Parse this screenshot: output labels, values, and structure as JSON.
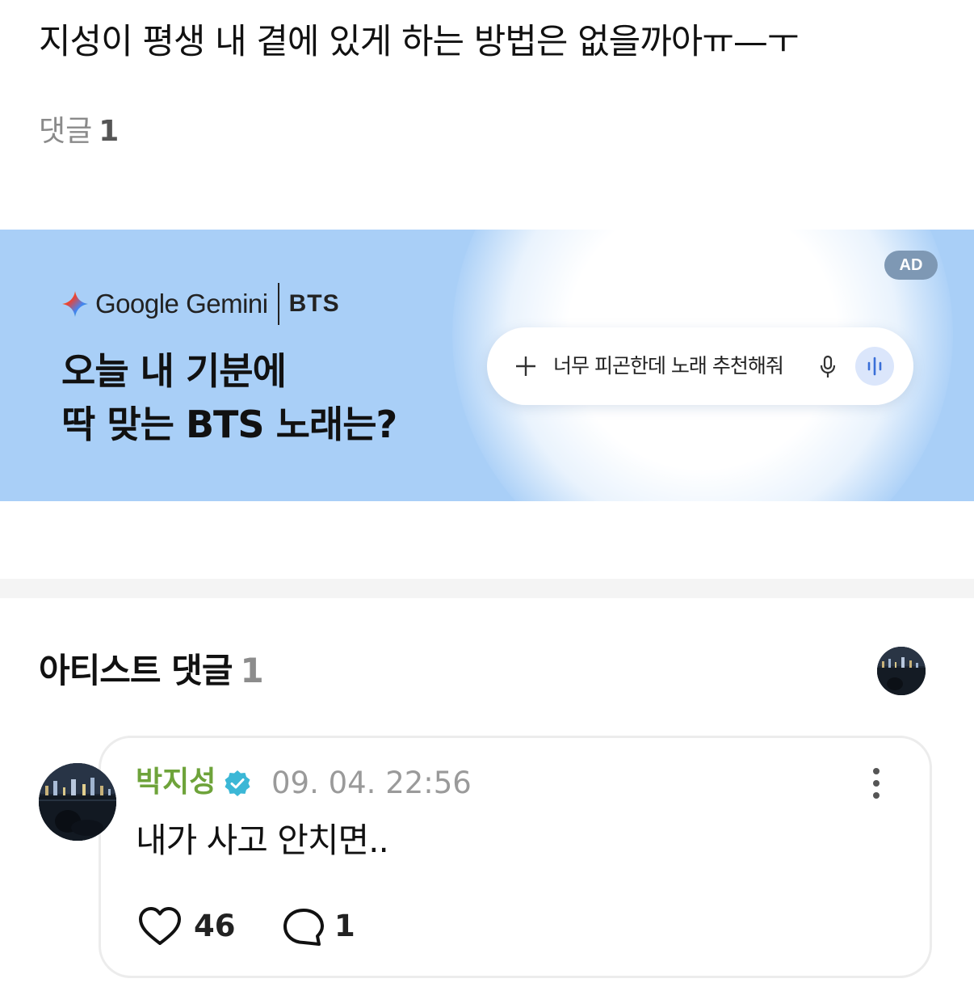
{
  "post": {
    "text": "지성이 평생 내 곁에 있게 하는 방법은 없을까아ㅠ—ㅜ",
    "comments_label": "댓글",
    "comments_count": "1"
  },
  "ad": {
    "badge": "AD",
    "brand": "Google Gemini",
    "partner": "BTS",
    "headline_line1": "오늘 내 기분에",
    "headline_line2": "딱 맞는 BTS 노래는?",
    "search_query": "너무 피곤한데 노래 추천해줘",
    "background_color": "#a9cff7",
    "icons": [
      "gemini-spark-icon",
      "plus-icon",
      "mic-icon",
      "voice-wave-icon"
    ]
  },
  "artist_comments": {
    "title": "아티스트 댓글",
    "count": "1"
  },
  "comment": {
    "author": "박지성",
    "timestamp": "09. 04. 22:56",
    "body": "내가 사고 안치면..",
    "likes": "46",
    "replies": "1",
    "author_color": "#6ea33a",
    "verified_color": "#3bb7d6",
    "icons": [
      "verified-icon",
      "more-icon",
      "heart-icon",
      "reply-bubble-icon"
    ]
  }
}
